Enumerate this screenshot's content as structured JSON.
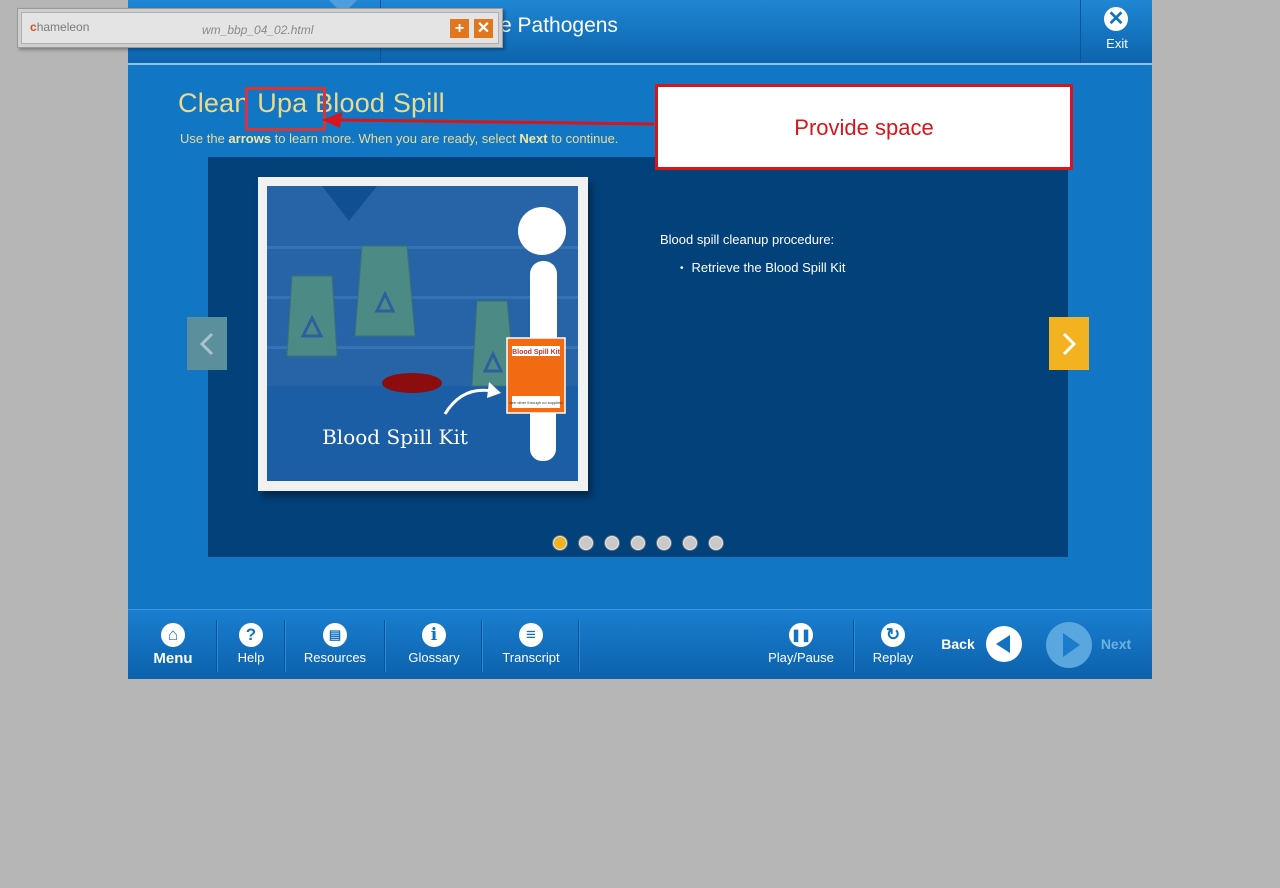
{
  "header": {
    "course_title": "e Pathogens",
    "exit_label": "Exit"
  },
  "content": {
    "title": "Clean Upa Blood Spill",
    "instruction_prefix": "Use the ",
    "instruction_arrows": "arrows",
    "instruction_middle": " to learn more.  When you are ready, select ",
    "instruction_next": "Next",
    "instruction_suffix": " to continue.",
    "procedure_title": "Blood spill cleanup procedure:",
    "procedure_items": [
      "Retrieve the Blood Spill Kit"
    ],
    "image": {
      "caption": "Blood Spill Kit",
      "kit_label": "Blood Spill Kit",
      "kit_small_text": "see other through no supplies"
    },
    "pagination": {
      "total": 7,
      "active": 1
    }
  },
  "footer": {
    "menu": "Menu",
    "help": "Help",
    "resources": "Resources",
    "glossary": "Glossary",
    "transcript": "Transcript",
    "play_pause": "Play/Pause",
    "replay": "Replay",
    "back": "Back",
    "next": "Next"
  },
  "chameleon": {
    "logo_text": "hameleon",
    "logo_c": "c",
    "filename": "wm_bbp_04_02.html"
  },
  "annotation": {
    "note": "Provide space"
  },
  "colors": {
    "title_yellow": "#ecd98a",
    "accent_orange": "#f3b21f",
    "annotation_red": "#d8151c",
    "panel_navy": "#03417a"
  }
}
